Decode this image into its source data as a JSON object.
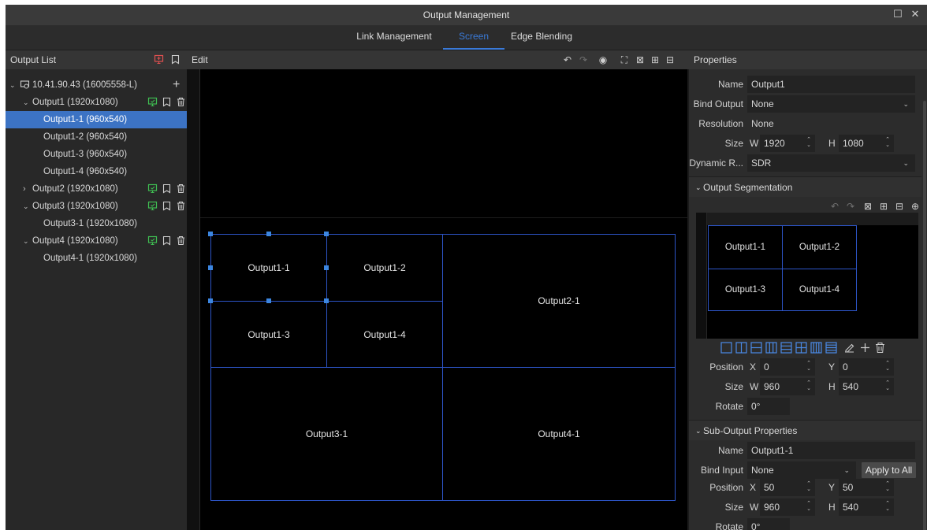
{
  "window": {
    "title": "Output Management",
    "maximize_glyph": "☐",
    "close_glyph": "✕"
  },
  "tabs": [
    {
      "label": "Link Management",
      "active": false
    },
    {
      "label": "Screen",
      "active": true
    },
    {
      "label": "Edge Blending",
      "active": false
    }
  ],
  "output_list": {
    "header": "Output List",
    "device": {
      "label": "10.41.90.43 (16005558-L)",
      "add_glyph": "+"
    },
    "rows": [
      {
        "label": "Output1 (1920x1080)",
        "expanded": true
      },
      {
        "label": "Output1-1 (960x540)",
        "selected": true
      },
      {
        "label": "Output1-2 (960x540)"
      },
      {
        "label": "Output1-3 (960x540)"
      },
      {
        "label": "Output1-4 (960x540)"
      },
      {
        "label": "Output2 (1920x1080)",
        "expanded": false
      },
      {
        "label": "Output3 (1920x1080)",
        "expanded": true
      },
      {
        "label": "Output3-1 (1920x1080)"
      },
      {
        "label": "Output4 (1920x1080)",
        "expanded": true
      },
      {
        "label": "Output4-1 (1920x1080)"
      }
    ]
  },
  "edit": {
    "header": "Edit",
    "segments": {
      "o11": "Output1-1",
      "o12": "Output1-2",
      "o13": "Output1-3",
      "o14": "Output1-4",
      "o21": "Output2-1",
      "o31": "Output3-1",
      "o41": "Output4-1"
    }
  },
  "properties": {
    "header": "Properties",
    "name_label": "Name",
    "name_value": "Output1",
    "bind_output_label": "Bind Output",
    "bind_output_value": "None",
    "resolution_label": "Resolution",
    "resolution_value": "None",
    "size_label": "Size",
    "w_label": "W",
    "w_value": "1920",
    "h_label": "H",
    "h_value": "1080",
    "dynamic_label": "Dynamic R...",
    "dynamic_value": "SDR",
    "segmentation": {
      "title": "Output Segmentation",
      "cells": {
        "a": "Output1-1",
        "b": "Output1-2",
        "c": "Output1-3",
        "d": "Output1-4"
      },
      "position_label": "Position",
      "x_label": "X",
      "x_value": "0",
      "y_label": "Y",
      "y_value": "0",
      "size_label": "Size",
      "w_label": "W",
      "w_value": "960",
      "h_label": "H",
      "h_value": "540",
      "rotate_label": "Rotate",
      "rotate_value": "0°"
    },
    "sub_output": {
      "title": "Sub-Output Properties",
      "name_label": "Name",
      "name_value": "Output1-1",
      "bind_input_label": "Bind Input",
      "bind_input_value": "None",
      "apply_all": "Apply to All",
      "position_label": "Position",
      "x_label": "X",
      "x_value": "50",
      "y_label": "Y",
      "y_value": "50",
      "size_label": "Size",
      "w_label": "W",
      "w_value": "960",
      "h_label": "H",
      "h_value": "540",
      "rotate_label": "Rotate",
      "rotate_value": "0°"
    }
  },
  "colors": {
    "accent": "#3a7ad8",
    "segment_border": "#2d55c8",
    "selection": "#3c73c4",
    "green_icon": "#3fbf52",
    "red_icon": "#e05050"
  }
}
